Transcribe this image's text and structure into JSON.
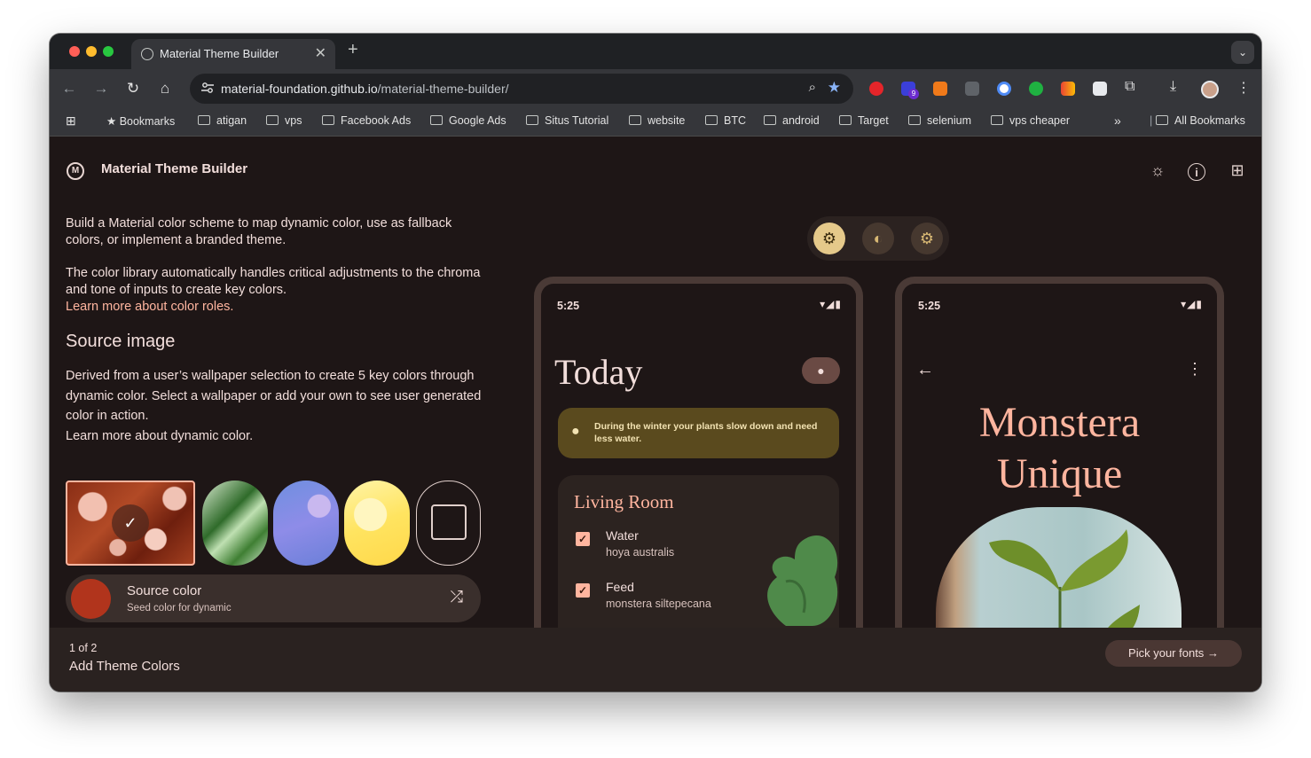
{
  "browser": {
    "tab_title": "Material Theme Builder",
    "tab_close": "✕",
    "new_tab": "+",
    "url_host": "material-foundation.github.io",
    "url_path": "/material-theme-builder/",
    "ext_badge": "9",
    "bookmarks": [
      "Bookmarks",
      "atigan",
      "vps",
      "Facebook Ads",
      "Google Ads",
      "Situs Tutorial",
      "website",
      "BTC",
      "android",
      "Target",
      "selenium",
      "vps cheaper"
    ],
    "bookmarks_overflow": "»",
    "all_bookmarks": "All Bookmarks"
  },
  "app": {
    "title": "Material Theme Builder",
    "intro_1": "Build a Material color scheme to map dynamic color, use as fallback colors, or implement a branded theme.",
    "intro_2": "The color library automatically handles critical adjustments to the chroma and tone of inputs to create key colors.",
    "intro_link": "Learn more about color roles.",
    "source_image_title": "Source image",
    "source_image_desc": "Derived from a user’s wallpaper selection to create 5 key colors through dynamic color. Select a wallpaper or add your own to see user generated color in action.",
    "source_image_link": "Learn more about dynamic color.",
    "source_color_label": "Source color",
    "source_color_sub": "Seed color for dynamic",
    "source_color_hex": "#b1341c"
  },
  "phone_left": {
    "time": "5:25",
    "heading": "Today",
    "tip": "During the winter your plants slow down and need less water.",
    "room": "Living Room",
    "todos": [
      {
        "name": "Water",
        "sub": "hoya australis"
      },
      {
        "name": "Feed",
        "sub": "monstera siltepecana"
      }
    ]
  },
  "phone_right": {
    "time": "5:25",
    "title_line1": "Monstera",
    "title_line2": "Unique"
  },
  "footer": {
    "count": "1 of 2",
    "step": "Add Theme Colors",
    "next_label": "Pick your fonts"
  },
  "colors": {
    "accent": "#ffb59f",
    "surface": "#1e1616",
    "seed": "#b1341c"
  }
}
